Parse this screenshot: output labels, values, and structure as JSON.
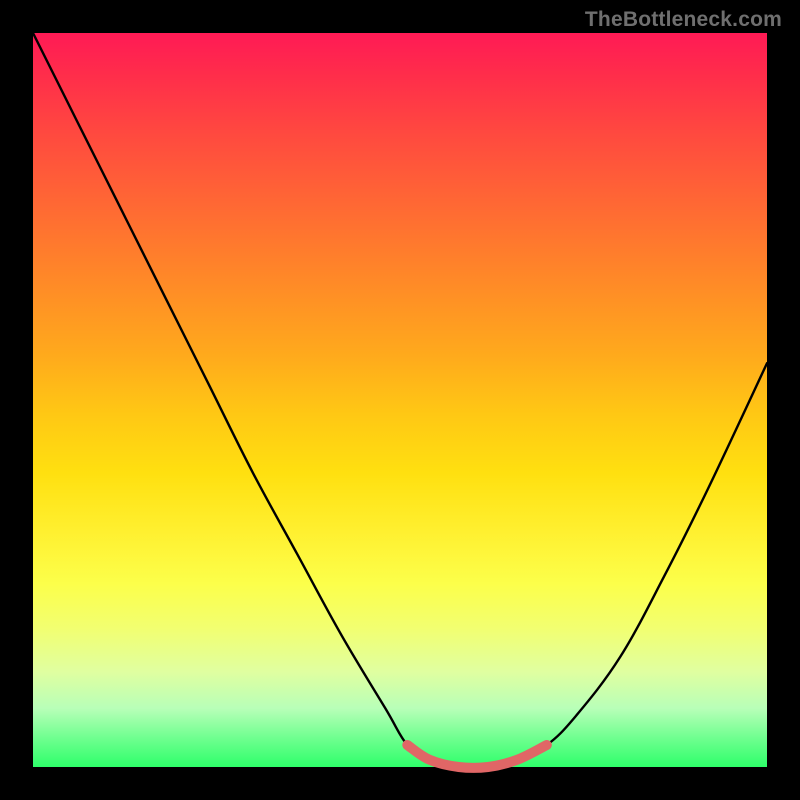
{
  "watermark": "TheBottleneck.com",
  "colors": {
    "curve": "#000000",
    "optimal_segment": "#e06666",
    "gradient_top": "#ff1a55",
    "gradient_bottom": "#2eff6a",
    "frame": "#000000"
  },
  "chart_data": {
    "type": "line",
    "title": "",
    "xlabel": "",
    "ylabel": "",
    "xlim": [
      0,
      100
    ],
    "ylim": [
      0,
      100
    ],
    "series": [
      {
        "name": "bottleneck_curve",
        "x": [
          0,
          6,
          12,
          18,
          24,
          30,
          36,
          42,
          48,
          51,
          54,
          58,
          62,
          66,
          70,
          74,
          80,
          86,
          92,
          100
        ],
        "values": [
          100,
          88,
          76,
          64,
          52,
          40,
          29,
          18,
          8,
          3,
          1,
          0,
          0,
          1,
          3,
          7,
          15,
          26,
          38,
          55
        ]
      }
    ],
    "optimal_range_x": [
      51,
      70
    ],
    "annotations": []
  }
}
